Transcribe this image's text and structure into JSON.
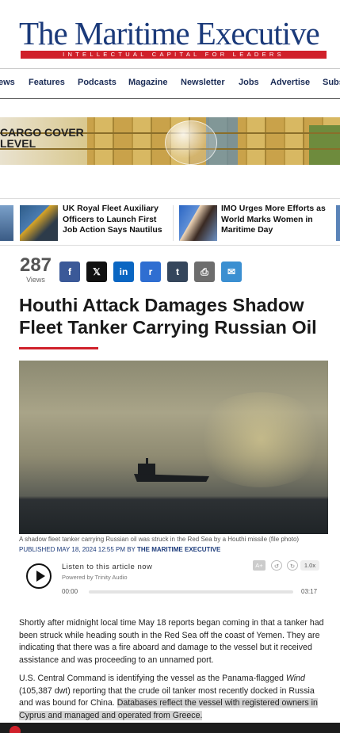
{
  "masthead": {
    "logo": "The Maritime Executive",
    "tagline": "INTELLECTUAL CAPITAL FOR LEADERS"
  },
  "nav": {
    "items": [
      "ews",
      "Features",
      "Podcasts",
      "Magazine",
      "Newsletter",
      "Jobs",
      "Advertise",
      "Subs"
    ]
  },
  "banner": {
    "line1": "CARGO COVER",
    "line2": "LEVEL"
  },
  "related": [
    {
      "title": "UK Royal Fleet Auxiliary Officers to Launch First Job Action Says Nautilus"
    },
    {
      "title": "IMO Urges More Efforts as World Marks Women in Maritime Day"
    }
  ],
  "views": {
    "count": "287",
    "label": "Views"
  },
  "share_buttons": [
    {
      "icon": "facebook-icon",
      "glyph": "f",
      "color": "#3b5998"
    },
    {
      "icon": "x-icon",
      "glyph": "𝕏",
      "color": "#111111"
    },
    {
      "icon": "linkedin-icon",
      "glyph": "in",
      "color": "#0a66c2"
    },
    {
      "icon": "reddit-icon",
      "glyph": "r",
      "color": "#2f6ed1"
    },
    {
      "icon": "tumblr-icon",
      "glyph": "t",
      "color": "#35465c"
    },
    {
      "icon": "print-icon",
      "glyph": "⎙",
      "color": "#6d6d6d"
    },
    {
      "icon": "email-icon",
      "glyph": "✉",
      "color": "#3b8fd1"
    }
  ],
  "article": {
    "headline": "Houthi Attack Damages Shadow Fleet Tanker Carrying Russian Oil",
    "caption": "A shadow fleet tanker carrying Russian oil was struck in the Red Sea by a Houthi missile (file photo)",
    "published": "PUBLISHED MAY 18, 2024 12:55 PM BY",
    "author": "THE MARITIME EXECUTIVE",
    "p1": "Shortly after midnight local time May 18 reports began coming in that a tanker had been struck while heading south in the Red Sea off the coast of Yemen. They are indicating that there was a fire aboard and damage to the vessel but it received assistance and was proceeding to an unnamed port.",
    "p2_a": "U.S. Central Command is identifying the vessel as the Panama-flagged ",
    "p2_vessel": "Wind",
    "p2_b": " (105,387 dwt) reporting that the crude oil tanker most recently docked in Russia and was bound for China. ",
    "p2_highlight": "Databases reflect the vessel with registered owners in Cyprus and managed and operated from Greece."
  },
  "audio": {
    "listen": "Listen to this article now",
    "powered": "Powered by Trinity Audio",
    "time_start": "00:00",
    "time_end": "03:17",
    "speed": "1.0x",
    "voice": "A+"
  }
}
